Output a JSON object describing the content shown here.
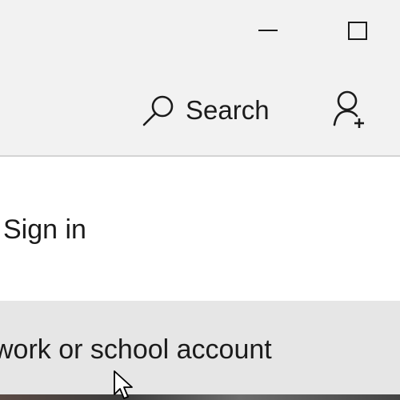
{
  "titlebar": {
    "minimize_icon": "minimize-icon",
    "maximize_icon": "maximize-icon"
  },
  "toolbar": {
    "search_label": "Search",
    "search_icon": "search-icon",
    "account_icon": "add-account-icon"
  },
  "content": {
    "sign_in_label": "Sign in",
    "account_option_label": "work or school account"
  },
  "colors": {
    "titlebar_bg": "#f2f2f2",
    "selected_option_bg": "#e6e6e6",
    "text": "#1b1b1b"
  }
}
